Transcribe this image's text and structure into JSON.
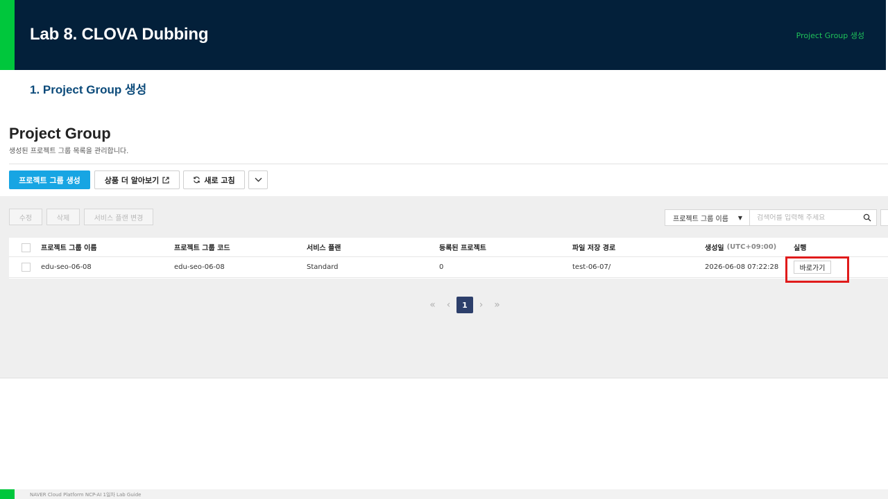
{
  "slide": {
    "title": "Lab 8. CLOVA Dubbing",
    "tag": "Project Group 생성",
    "step": "1. Project Group 생성",
    "footer": "NAVER Cloud Platform  NCP-AI 1일차 Lab Guide"
  },
  "console": {
    "title": "Project Group",
    "description": "생성된 프로젝트 그룹 목록을 관리합니다.",
    "toolbar": {
      "create": "프로젝트 그룹 생성",
      "learn_more": "상품 더 알아보기",
      "refresh": "새로 고침"
    },
    "actions": {
      "edit": "수정",
      "delete": "삭제",
      "change_plan": "서비스 플랜 변경"
    },
    "filter": {
      "selected": "프로젝트 그룹 이름",
      "placeholder": "검색어를 입력해 주세요"
    },
    "table": {
      "headers": {
        "name": "프로젝트 그룹 이름",
        "code": "프로젝트 그룹 코드",
        "plan": "서비스 플랜",
        "projects": "등록된 프로젝트",
        "path": "파일 저장 경로",
        "created": "생성일",
        "created_tz": "(UTC+09:00)",
        "run": "실행"
      },
      "rows": [
        {
          "name": "edu-seo-06-08",
          "code": "edu-seo-06-08",
          "plan": "Standard",
          "projects": "0",
          "path": "test-06-07/",
          "created": "2026-06-08 07:22:28",
          "run": "바로가기"
        }
      ]
    },
    "pagination": {
      "current": "1"
    }
  },
  "colors": {
    "header_bg": "#03203a",
    "accent_green": "#00c73c",
    "primary_button": "#17a5e3",
    "highlight_red": "#e01b1b",
    "pager_active": "#2d3f6b"
  }
}
